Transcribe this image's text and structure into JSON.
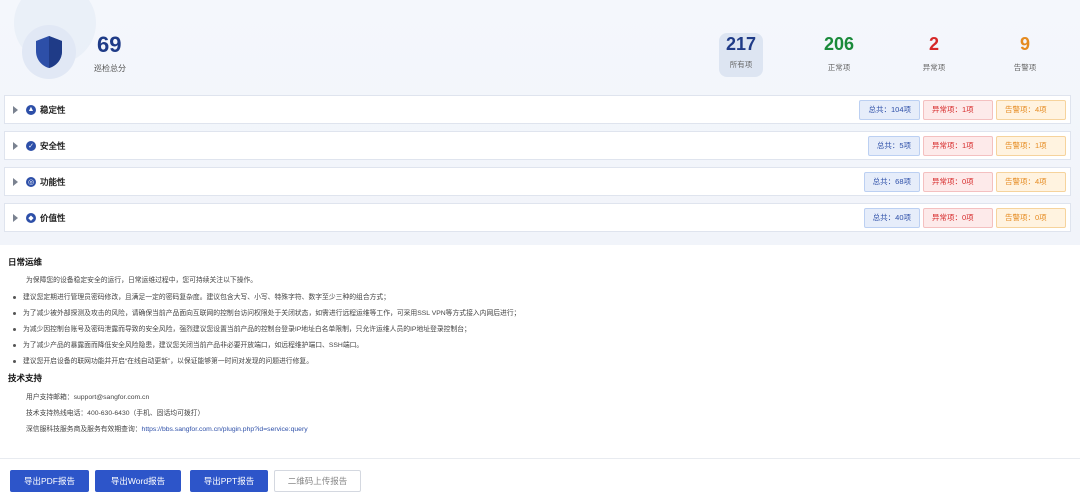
{
  "summary": {
    "score": "69",
    "score_label": "巡检总分",
    "stats": [
      {
        "value": "217",
        "label": "所有项"
      },
      {
        "value": "206",
        "label": "正常项"
      },
      {
        "value": "2",
        "label": "异常项"
      },
      {
        "value": "9",
        "label": "告警项"
      }
    ]
  },
  "categories": [
    {
      "title": "稳定性",
      "icon": "stability-icon",
      "total": "总共：104项",
      "abnormal": "异常项：1项",
      "warning": "告警项：4项"
    },
    {
      "title": "安全性",
      "icon": "security-icon",
      "total": "总共：5项",
      "abnormal": "异常项：1项",
      "warning": "告警项：1项"
    },
    {
      "title": "功能性",
      "icon": "function-icon",
      "total": "总共：68项",
      "abnormal": "异常项：0项",
      "warning": "告警项：4项"
    },
    {
      "title": "价值性",
      "icon": "value-icon",
      "total": "总共：40项",
      "abnormal": "异常项：0项",
      "warning": "告警项：0项"
    }
  ],
  "maintenance": {
    "title": "日常运维",
    "intro": "为保障您的设备稳定安全的运行，日常运维过程中，您可持续关注以下操作。",
    "tips": [
      "建议您定期进行管理员密码修改，且满足一定的密码复杂度。建议包含大写、小写、特殊字符、数字至少三种的组合方式；",
      "为了减少被外部探测及攻击的风险，请确保当前产品面向互联网的控制台访问权限处于关闭状态，如需进行远程运维等工作，可采用SSL VPN等方式接入内网后进行；",
      "为减少因控制台账号及密码泄露而导致的安全风险，强烈建议您设置当前产品的控制台登录IP地址白名单限制，只允许运维人员的IP地址登录控制台；",
      "为了减少产品的暴露面而降低安全风险隐患，建议您关闭当前产品非必要开放端口，如远程维护端口、SSH端口。",
      "建议您开启设备的联网功能并开启“在线自动更新”，以保证能够第一时间对发现的问题进行修复。"
    ]
  },
  "support": {
    "title": "技术支持",
    "email_label": "用户支持邮箱：",
    "email": "support@sangfor.com.cn",
    "hotline": "技术支持热线电话：400-630-6430（手机、固话均可拨打）",
    "query_label": "深信服科技服务商及服务有效期查询：",
    "query_url": "https://bbs.sangfor.com.cn/plugin.php?id=service:query"
  },
  "actions": {
    "export_pdf": "导出PDF报告",
    "export_word": "导出Word报告",
    "export_ppt": "导出PPT报告",
    "qr_upload": "二维码上传报告"
  }
}
